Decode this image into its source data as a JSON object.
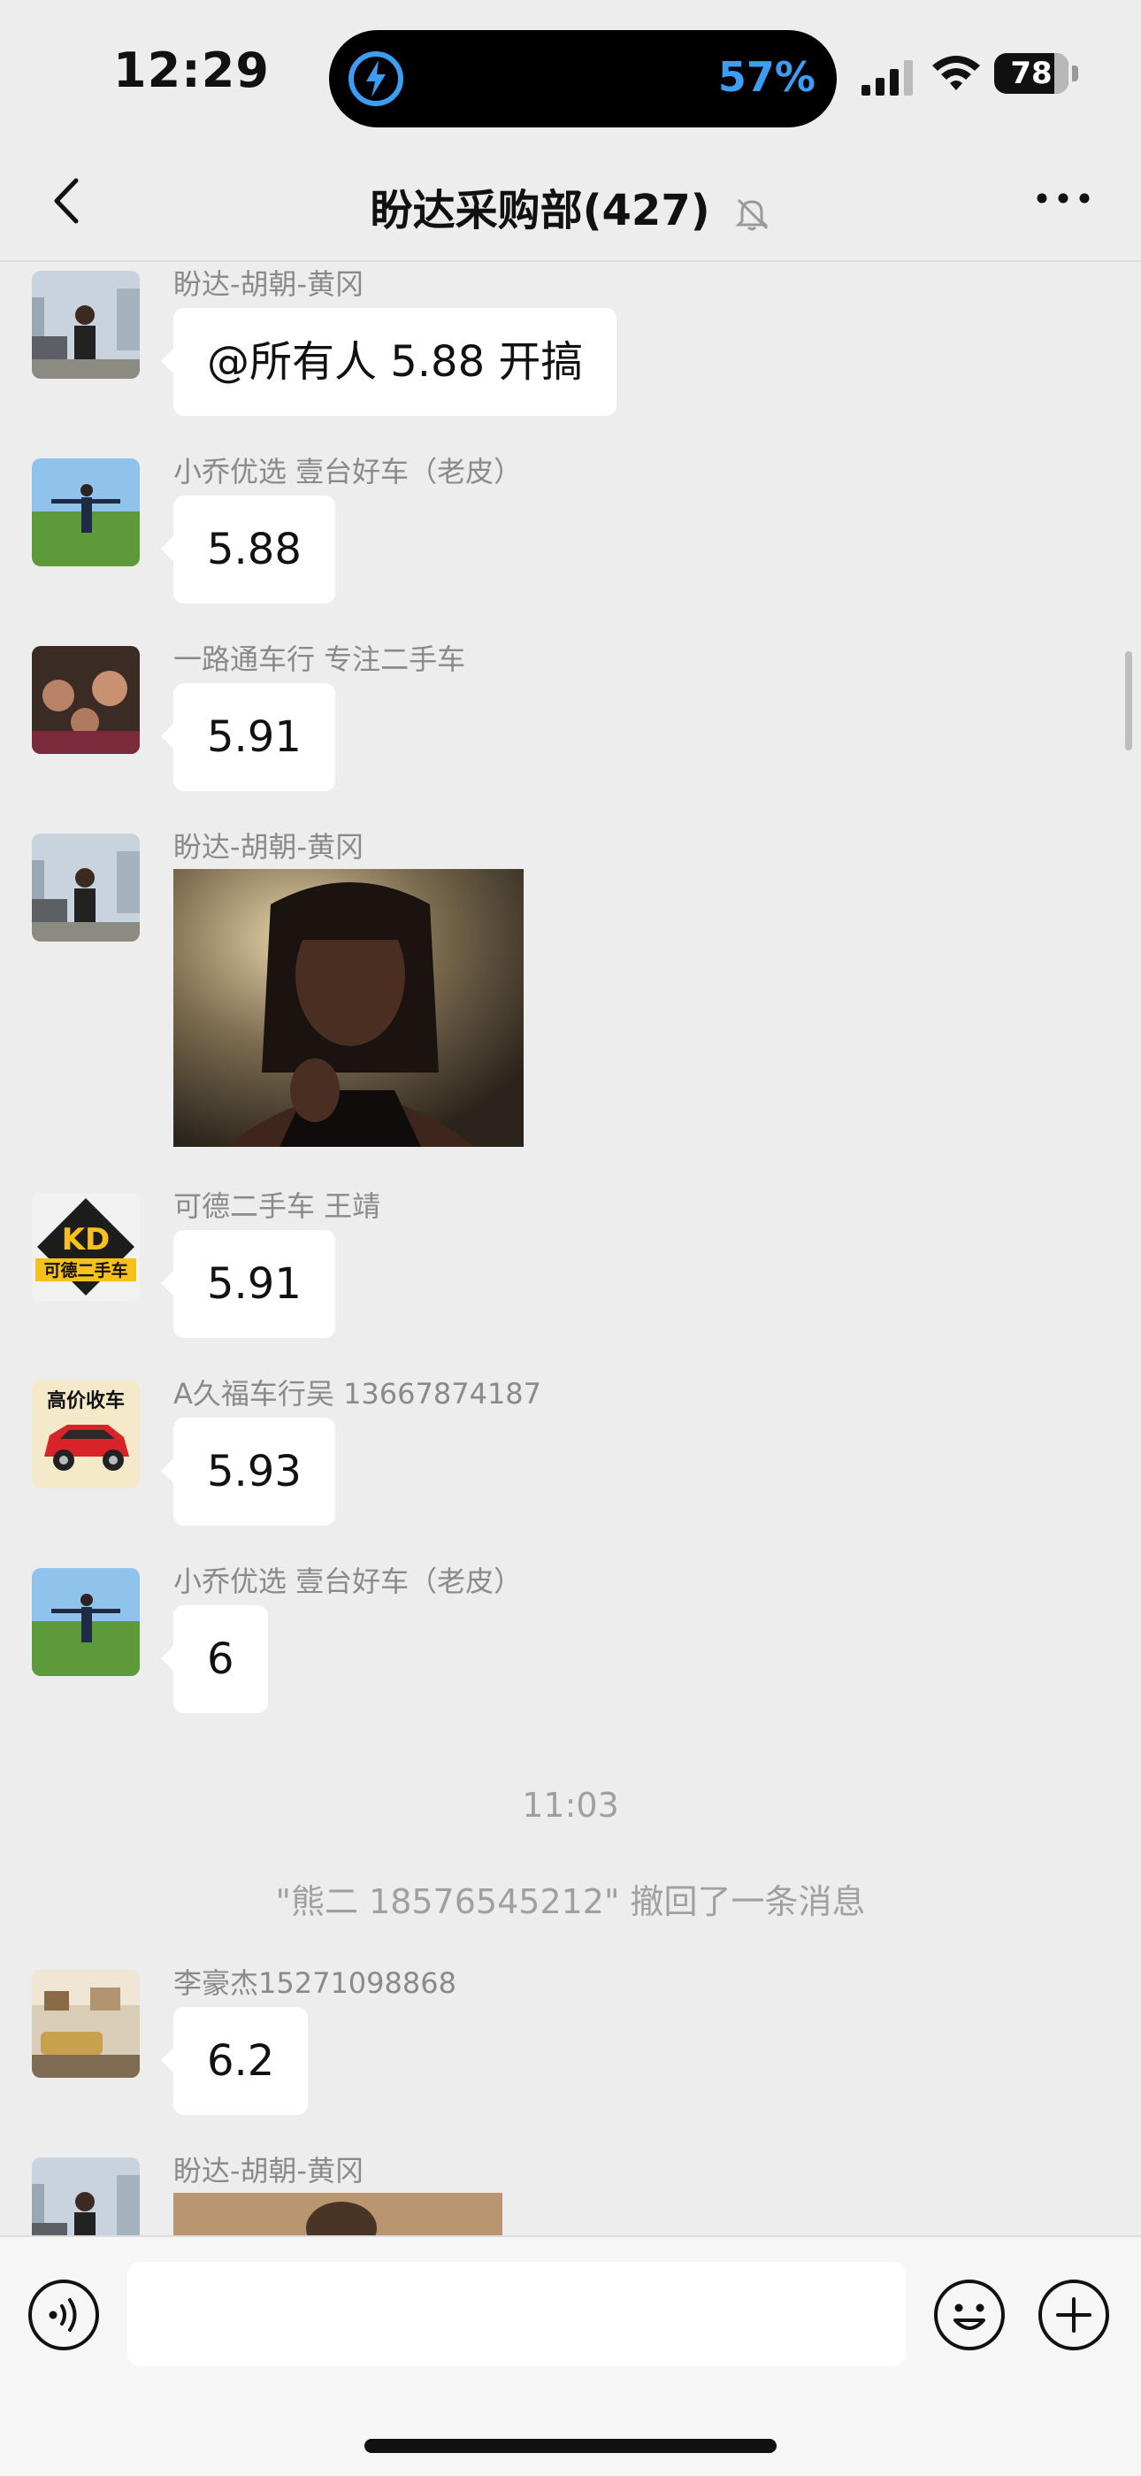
{
  "status_bar": {
    "time": "12:29",
    "battery_percent": "57%",
    "battery_level": "78"
  },
  "header": {
    "back_icon": "chevron-left-icon",
    "title": "盼达采购部(427)",
    "mute_icon": "bell-slash-icon",
    "more_icon": "ellipsis-icon"
  },
  "messages": [
    {
      "sender": "盼达-胡朝-黄冈",
      "text": "@所有人 5.88 开搞"
    },
    {
      "sender": "小乔优选 壹台好车（老皮）",
      "text": "5.88"
    },
    {
      "sender": "一路通车行 专注二手车",
      "text": "5.91"
    },
    {
      "sender": "盼达-胡朝-黄冈",
      "text": ""
    },
    {
      "sender": "可德二手车 王靖",
      "text": "5.91"
    },
    {
      "sender": "A久福车行吴 13667874187",
      "text": "5.93"
    },
    {
      "sender": "小乔优选 壹台好车（老皮）",
      "text": "6"
    },
    {
      "sender": "李豪杰15271098868",
      "text": "6.2"
    },
    {
      "sender": "盼达-胡朝-黄冈",
      "text": ""
    }
  ],
  "time_divider": "11:03",
  "system_message": "\"熊二 18576545212\" 撤回了一条消息",
  "avatars": {
    "kd_logo_text": "KD",
    "kd_logo_sub": "可德二手车",
    "car_logo_text": "高价收车"
  },
  "input_bar": {
    "voice_icon": "voice-icon",
    "input_value": "",
    "emoji_icon": "smiley-icon",
    "plus_icon": "plus-circle-icon"
  },
  "colors": {
    "background": "#ededed",
    "bubble": "#ffffff",
    "accent": "#3d9df3"
  }
}
